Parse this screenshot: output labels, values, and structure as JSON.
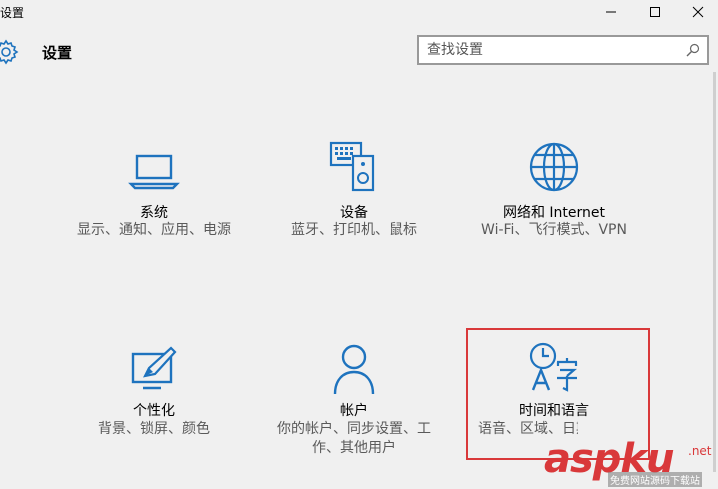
{
  "window": {
    "title": "设置",
    "minimize_icon": "minimize-icon",
    "maximize_icon": "maximize-icon",
    "close_icon": "close-icon"
  },
  "header": {
    "title": "设置",
    "icon": "gear-icon"
  },
  "search": {
    "placeholder": "查找设置",
    "icon": "search-icon"
  },
  "tiles": [
    {
      "name": "系统",
      "desc": "显示、通知、应用、电源",
      "icon": "laptop-icon"
    },
    {
      "name": "设备",
      "desc": "蓝牙、打印机、鼠标",
      "icon": "devices-icon"
    },
    {
      "name": "网络和 Internet",
      "desc": "Wi-Fi、飞行模式、VPN",
      "icon": "globe-icon"
    },
    {
      "name": "个性化",
      "desc": "背景、锁屏、颜色",
      "icon": "personalization-icon"
    },
    {
      "name": "帐户",
      "desc": "你的帐户、同步设置、工作、其他用户",
      "icon": "person-icon"
    },
    {
      "name": "时间和语言",
      "desc": "语音、区域、日期",
      "icon": "time-language-icon"
    }
  ],
  "colors": {
    "accent": "#1e73be",
    "highlight": "#d9383a",
    "background": "#f0f0f0"
  },
  "watermark": {
    "main": "aspku",
    "tld": ".net",
    "sub": "免费网站源码下载站"
  }
}
